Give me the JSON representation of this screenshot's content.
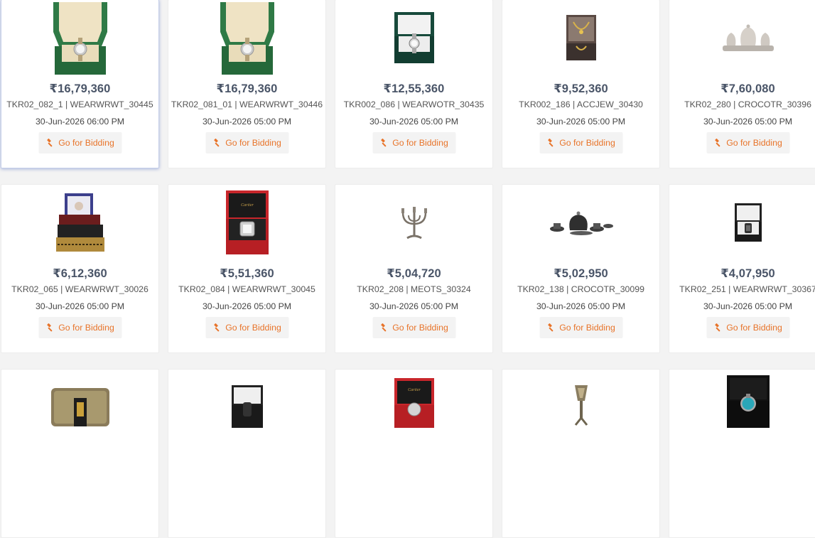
{
  "bid_label": "Go for Bidding",
  "lots": [
    {
      "price": "₹16,79,360",
      "code": "TKR02_082_1 | WEARWRWT_30445",
      "date": "30-Jun-2026 06:00 PM",
      "image": "rolex-box-icon"
    },
    {
      "price": "₹16,79,360",
      "code": "TKR02_081_01 | WEARWRWT_30446",
      "date": "30-Jun-2026 05:00 PM",
      "image": "rolex-box-icon"
    },
    {
      "price": "₹12,55,360",
      "code": "TKR002_086 | WEARWOTR_30435",
      "date": "30-Jun-2026 05:00 PM",
      "image": "watch-box-icon"
    },
    {
      "price": "₹9,52,360",
      "code": "TKR002_186 | ACCJEW_30430",
      "date": "30-Jun-2026 05:00 PM",
      "image": "jewelry-case-icon"
    },
    {
      "price": "₹7,60,080",
      "code": "TKR02_280 | CROCOTR_30396",
      "date": "30-Jun-2026 05:00 PM",
      "image": "silver-tea-set-icon"
    },
    {
      "price": "₹6,12,360",
      "code": "TKR02_065 | WEARWRWT_30026",
      "date": "30-Jun-2026 05:00 PM",
      "image": "ornate-box-icon"
    },
    {
      "price": "₹5,51,360",
      "code": "TKR02_084 | WEARWRWT_30045",
      "date": "30-Jun-2026 05:00 PM",
      "image": "cartier-box-icon"
    },
    {
      "price": "₹5,04,720",
      "code": "TKR02_208 | MEOTS_30324",
      "date": "30-Jun-2026 05:00 PM",
      "image": "candelabra-icon"
    },
    {
      "price": "₹5,02,950",
      "code": "TKR02_138 | CROCOTR_30099",
      "date": "30-Jun-2026 05:00 PM",
      "image": "dark-tea-set-icon"
    },
    {
      "price": "₹4,07,950",
      "code": "TKR02_251 | WEARWRWT_30367",
      "date": "30-Jun-2026 05:00 PM",
      "image": "watch-box-black-icon"
    },
    {
      "price": "",
      "code": "",
      "date": "",
      "image": "gold-case-icon"
    },
    {
      "price": "",
      "code": "",
      "date": "",
      "image": "watch-box-black-icon"
    },
    {
      "price": "",
      "code": "",
      "date": "",
      "image": "cartier-box-icon"
    },
    {
      "price": "",
      "code": "",
      "date": "",
      "image": "silver-stand-icon"
    },
    {
      "price": "",
      "code": "",
      "date": "",
      "image": "watch-box-teal-icon"
    }
  ]
}
